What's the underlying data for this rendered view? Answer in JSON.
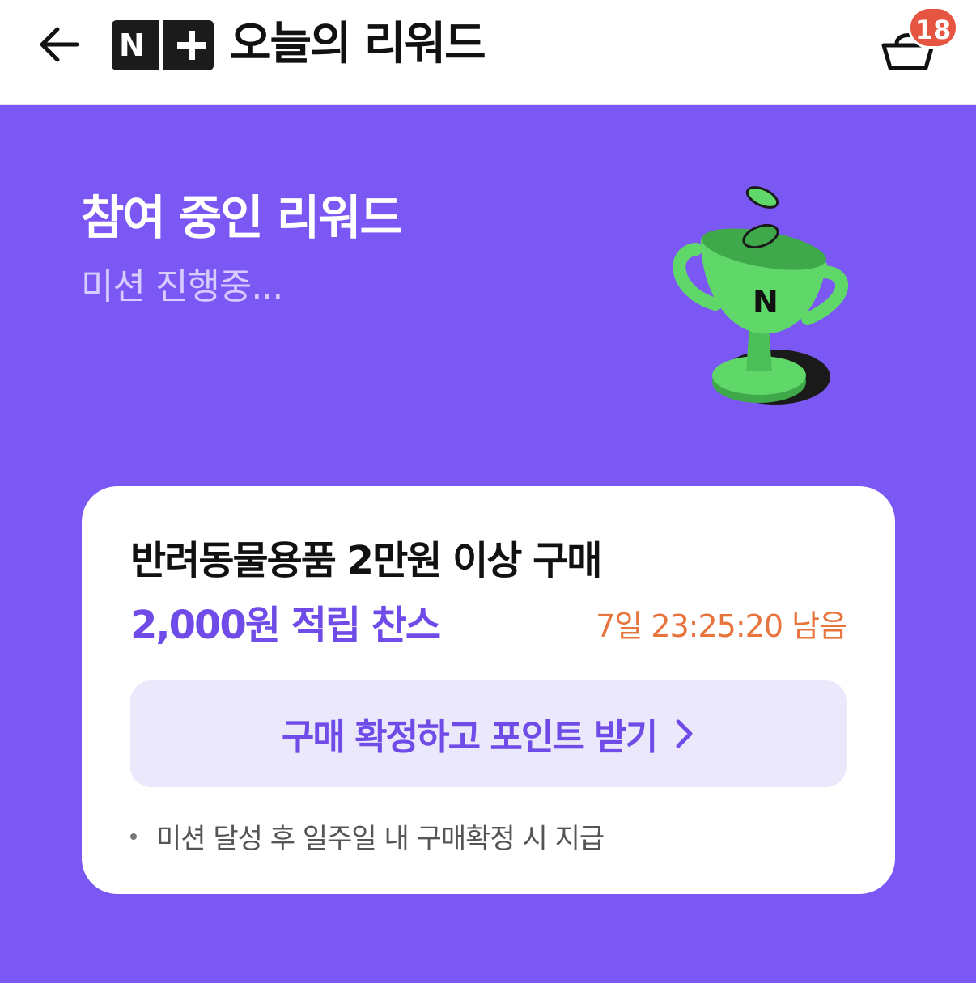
{
  "header": {
    "logo_letter": "N",
    "title": "오늘의 리워드",
    "cart_badge": "18"
  },
  "hero": {
    "title": "참여 중인 리워드",
    "subtitle": "미션 진행중..."
  },
  "card": {
    "mission": "반려동물용품 2만원 이상 구매",
    "reward": "2,000원 적립 찬스",
    "time_left": "7일 23:25:20 남음",
    "cta_label": "구매 확정하고 포인트 받기",
    "note": "미션 달성 후 일주일 내 구매확정 시 지급"
  },
  "icons": {
    "back": "arrow-left-icon",
    "cart": "basket-icon",
    "trophy": "trophy-icon",
    "chevron": "chevron-right-icon"
  },
  "colors": {
    "background": "#7B58F3",
    "accent": "#6F4BE8",
    "timer": "#E7743D",
    "badge": "#E65442",
    "trophy": "#5FD869"
  }
}
